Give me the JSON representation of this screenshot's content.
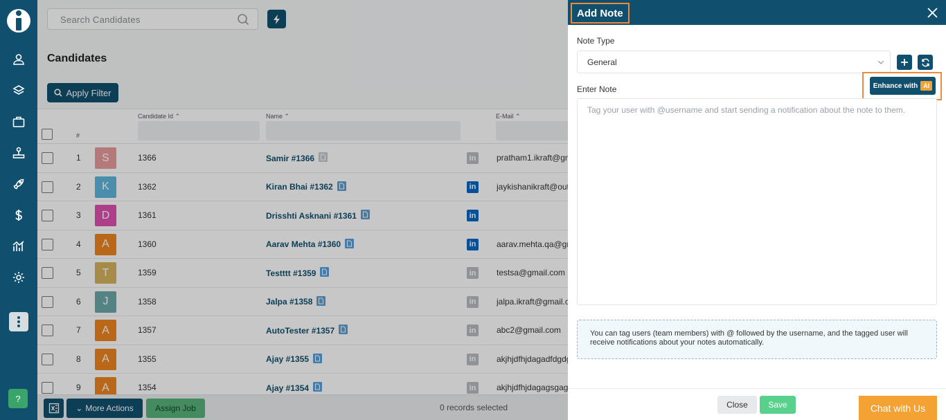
{
  "search": {
    "placeholder": "Search Candidates"
  },
  "page": {
    "title": "Candidates",
    "apply_filter": "Apply Filter"
  },
  "table": {
    "columns": {
      "hash": "#",
      "candidate_id": "Candidate Id",
      "name": "Name",
      "email": "E-Mail"
    },
    "rows": [
      {
        "num": "1",
        "initial": "S",
        "color": "#e89c9c",
        "id": "1366",
        "name": "Samir #1366",
        "email": "pratham1.ikraft@gm",
        "doc": "gray",
        "li": "gray"
      },
      {
        "num": "2",
        "initial": "K",
        "color": "#5fb6dc",
        "id": "1362",
        "name": "Kiran Bhai #1362",
        "email": "jaykishanikraft@out",
        "doc": "blue",
        "li": "blue"
      },
      {
        "num": "3",
        "initial": "D",
        "color": "#df4fb1",
        "id": "1361",
        "name": "Drisshti Asknani #1361",
        "email": "",
        "doc": "blue",
        "li": "blue"
      },
      {
        "num": "4",
        "initial": "A",
        "color": "#ee8420",
        "id": "1360",
        "name": "Aarav Mehta #1360",
        "email": "aarav.mehta.qa@gm",
        "doc": "blue",
        "li": "blue"
      },
      {
        "num": "5",
        "initial": "T",
        "color": "#d7b35d",
        "id": "1359",
        "name": "Testttt #1359",
        "email": "testsa@gmail.com",
        "doc": "blue",
        "li": "gray"
      },
      {
        "num": "6",
        "initial": "J",
        "color": "#6ea8a8",
        "id": "1358",
        "name": "Jalpa #1358",
        "email": "jalpa.ikraft@gmail.c",
        "doc": "blue",
        "li": "gray"
      },
      {
        "num": "7",
        "initial": "A",
        "color": "#ee8420",
        "id": "1357",
        "name": "AutoTester #1357",
        "email": "abc2@gmail.com",
        "doc": "blue",
        "li": "gray"
      },
      {
        "num": "8",
        "initial": "A",
        "color": "#ee8420",
        "id": "1355",
        "name": "Ajay #1355",
        "email": "akjhjdfhjdagadfdgdg",
        "doc": "blue",
        "li": "gray"
      },
      {
        "num": "9",
        "initial": "A",
        "color": "#ee8420",
        "id": "1354",
        "name": "Ajay #1354",
        "email": "akjhjdfhjdagagsgag",
        "doc": "blue",
        "li": "gray"
      }
    ]
  },
  "footer": {
    "more_actions": "More Actions",
    "assign_job": "Assign Job",
    "selected": "0 records selected"
  },
  "sidebar": {
    "help": "?"
  },
  "panel": {
    "title": "Add Note",
    "note_type_label": "Note Type",
    "note_type_value": "General",
    "enter_note_label": "Enter Note",
    "enhance_label": "Enhance with",
    "ai_badge": "AI",
    "note_placeholder": "Tag your user with @username and start sending a notification about the note to them.",
    "info_text": "You can tag users (team members) with @ followed by the username, and the tagged user will receive notifications about your notes automatically.",
    "close": "Close",
    "save": "Save",
    "chat": "Chat with Us"
  },
  "colors": {
    "brand": "#10506e",
    "accent": "#f3a233",
    "success": "#58d18c",
    "linkedin": "#0a66c2"
  }
}
